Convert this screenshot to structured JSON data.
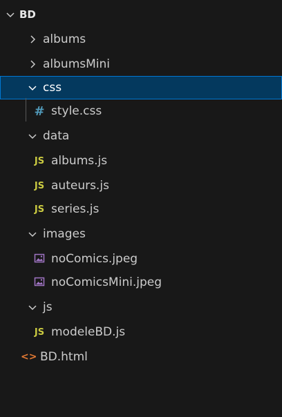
{
  "explorer": {
    "root": {
      "label": "BD",
      "expanded": true
    },
    "items": [
      {
        "label": "albums",
        "type": "folder",
        "expanded": false
      },
      {
        "label": "albumsMini",
        "type": "folder",
        "expanded": false
      },
      {
        "label": "css",
        "type": "folder",
        "expanded": true,
        "selected": true
      },
      {
        "label": "style.css",
        "type": "file",
        "icon": "css-icon",
        "icon_text": "#"
      },
      {
        "label": "data",
        "type": "folder",
        "expanded": true
      },
      {
        "label": "albums.js",
        "type": "file",
        "icon": "js-icon",
        "icon_text": "JS"
      },
      {
        "label": "auteurs.js",
        "type": "file",
        "icon": "js-icon",
        "icon_text": "JS"
      },
      {
        "label": "series.js",
        "type": "file",
        "icon": "js-icon",
        "icon_text": "JS"
      },
      {
        "label": "images",
        "type": "folder",
        "expanded": true
      },
      {
        "label": "noComics.jpeg",
        "type": "file",
        "icon": "image-icon"
      },
      {
        "label": "noComicsMini.jpeg",
        "type": "file",
        "icon": "image-icon"
      },
      {
        "label": "js",
        "type": "folder",
        "expanded": true
      },
      {
        "label": "modeleBD.js",
        "type": "file",
        "icon": "js-icon",
        "icon_text": "JS"
      },
      {
        "label": "BD.html",
        "type": "file",
        "icon": "html-icon",
        "icon_text": "<>"
      }
    ]
  },
  "colors": {
    "background": "#181818",
    "selected_background": "#04395e",
    "selected_border": "#0078d4",
    "text": "#cccccc",
    "js_icon": "#cbcb41",
    "css_icon": "#519aba",
    "html_icon": "#e37933",
    "image_icon": "#a074c4"
  }
}
